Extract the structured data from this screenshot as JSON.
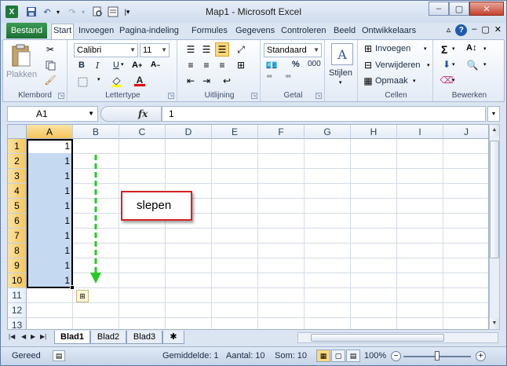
{
  "window": {
    "title": "Map1 - Microsoft Excel"
  },
  "title_buttons": {
    "minimize": "–",
    "restore": "▢",
    "close": "✕"
  },
  "ribbon_tabs": [
    "Bestand",
    "Start",
    "Invoegen",
    "Pagina-indeling",
    "Formules",
    "Gegevens",
    "Controleren",
    "Beeld",
    "Ontwikkelaars"
  ],
  "ribbon": {
    "clipboard": {
      "paste": "Plakken",
      "label": "Klembord"
    },
    "font": {
      "name": "Calibri",
      "size": "11",
      "bold": "B",
      "italic": "I",
      "underline": "U",
      "label": "Lettertype"
    },
    "alignment": {
      "label": "Uitlijning"
    },
    "number": {
      "format": "Standaard",
      "percent": "%",
      "thousands": "000",
      "label": "Getal"
    },
    "styles": {
      "label": "Stijlen"
    },
    "cells": {
      "insert": "Invoegen",
      "delete": "Verwijderen",
      "format": "Opmaak",
      "label": "Cellen"
    },
    "editing": {
      "label": "Bewerken"
    }
  },
  "formula_bar": {
    "name_box": "A1",
    "fx": "fx",
    "formula": "1"
  },
  "grid": {
    "columns": [
      "A",
      "B",
      "C",
      "D",
      "E",
      "F",
      "G",
      "H",
      "I",
      "J"
    ],
    "rows": [
      "1",
      "2",
      "3",
      "4",
      "5",
      "6",
      "7",
      "8",
      "9",
      "10",
      "11",
      "12",
      "13"
    ],
    "values": [
      "1",
      "1",
      "1",
      "1",
      "1",
      "1",
      "1",
      "1",
      "1",
      "1"
    ],
    "selected_column": "A",
    "selected_rows": 10
  },
  "annotation": {
    "callout_text": "slepen"
  },
  "sheets": {
    "tabs": [
      "Blad1",
      "Blad2",
      "Blad3"
    ],
    "active": "Blad1"
  },
  "status": {
    "mode": "Gereed",
    "average": "Gemiddelde: 1",
    "count": "Aantal: 10",
    "sum": "Som: 10",
    "zoom": "100%",
    "zoom_minus": "−",
    "zoom_plus": "+"
  },
  "colors": {
    "accent_green": "#1d6f34",
    "selection": "#c5d9f1",
    "header_highlight": "#f5c55a",
    "callout_border": "#d42323",
    "drag_arrow": "#22cc22"
  }
}
